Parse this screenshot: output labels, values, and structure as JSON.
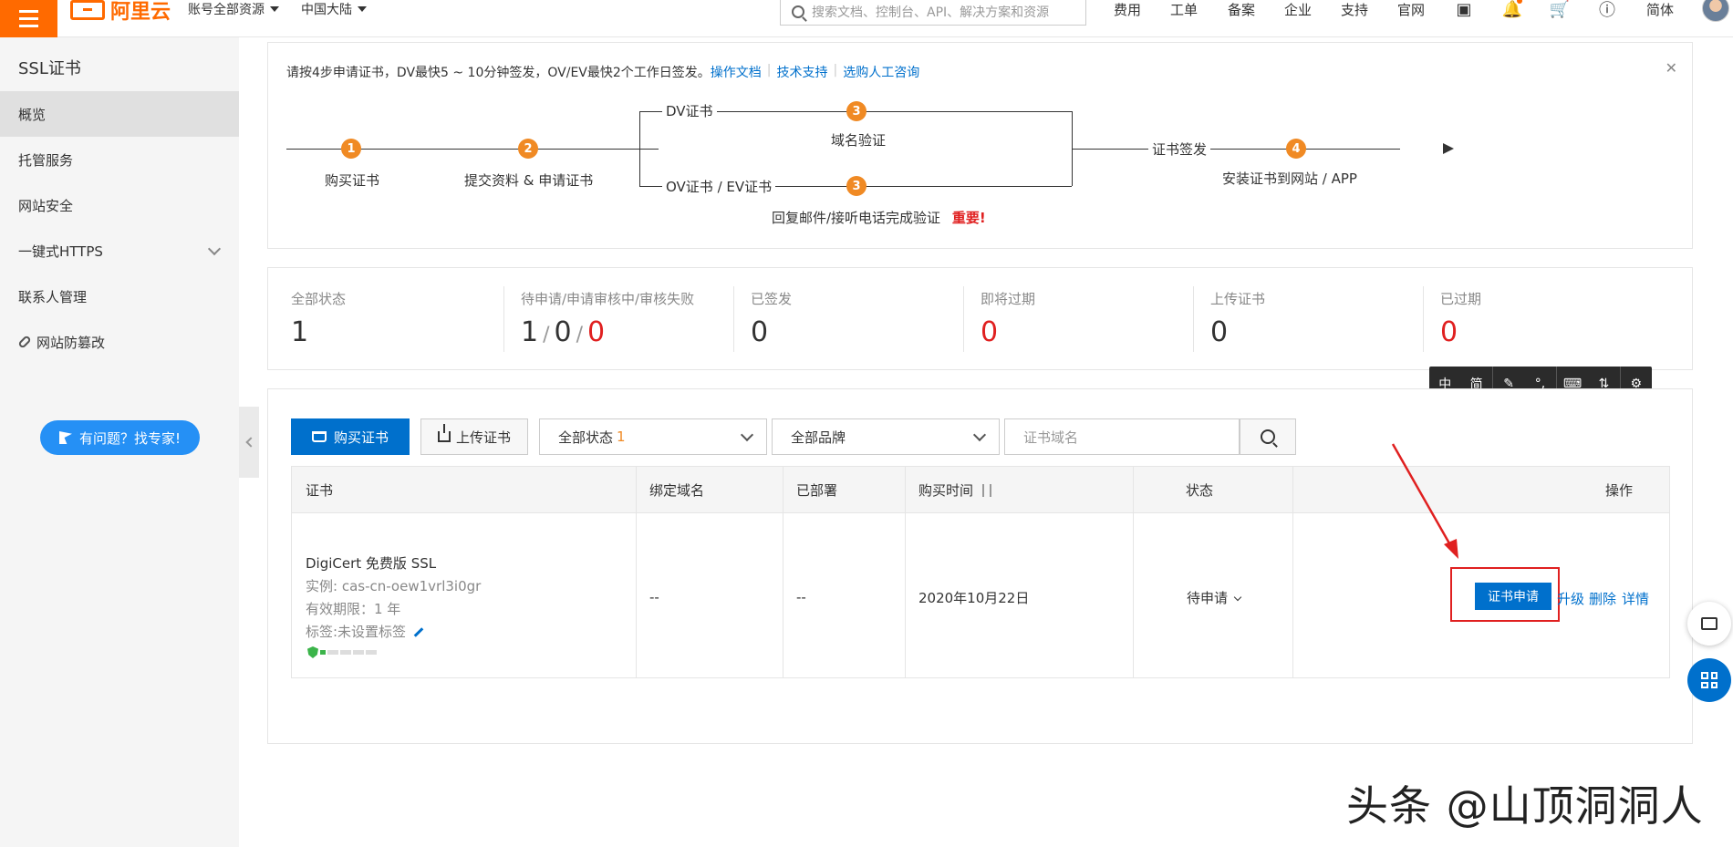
{
  "topbar": {
    "brand": "阿里云",
    "account_scope": "账号全部资源",
    "region": "中国大陆",
    "search_placeholder": "搜索文档、控制台、API、解决方案和资源",
    "nav": [
      "费用",
      "工单",
      "备案",
      "企业",
      "支持",
      "官网"
    ],
    "language": "简体"
  },
  "sidebar": {
    "title": "SSL证书",
    "items": [
      {
        "label": "概览",
        "active": true
      },
      {
        "label": "托管服务"
      },
      {
        "label": "网站安全"
      },
      {
        "label": "一键式HTTPS",
        "expandable": true
      },
      {
        "label": "联系人管理"
      },
      {
        "label": "网站防篡改",
        "icon": "link-icon"
      }
    ],
    "expert_button": "有问题？找专家!"
  },
  "guide": {
    "intro": "请按4步申请证书，DV最快5 ~ 10分钟签发，OV/EV最快2个工作日签发。",
    "links": [
      "操作文档",
      "技术支持",
      "选购人工咨询"
    ],
    "steps": {
      "s1": "1",
      "s2": "2",
      "s3": "3",
      "s4": "4",
      "buy": "购买证书",
      "submit": "提交资料 & 申请证书",
      "dv": "DV证书",
      "domain_verify": "域名验证",
      "ovev": "OV证书 / EV证书",
      "mail_verify": "回复邮件/接听电话完成验证",
      "important": "重要!",
      "issue": "证书签发",
      "install": "安装证书到网站 / APP"
    }
  },
  "stats": [
    {
      "label": "全部状态",
      "value": "1"
    },
    {
      "label": "待申请/申请审核中/审核失败",
      "values": [
        "1",
        "0",
        "0"
      ]
    },
    {
      "label": "已签发",
      "value": "0"
    },
    {
      "label": "即将过期",
      "value": "0",
      "red": true
    },
    {
      "label": "上传证书",
      "value": "0"
    },
    {
      "label": "已过期",
      "value": "0",
      "red": true
    }
  ],
  "float_toolbar": [
    "中",
    "简"
  ],
  "toolbar": {
    "buy": "购买证书",
    "upload": "上传证书",
    "status_filter": "全部状态",
    "status_count": "1",
    "brand_filter": "全部品牌",
    "domain_placeholder": "证书域名"
  },
  "table": {
    "headers": [
      "证书",
      "绑定域名",
      "已部署",
      "购买时间",
      "状态",
      "操作"
    ],
    "rows": [
      {
        "name": "DigiCert 免费版 SSL",
        "instance": "实例: cas-cn-oew1vrl3i0gr",
        "validity": "有效期限：1 年",
        "tags": "标签:未设置标签",
        "domain": "--",
        "deployed": "--",
        "purchase_time": "2020年10月22日",
        "status": "待申请",
        "actions": {
          "apply": "证书申请",
          "upgrade": "升级",
          "delete": "删除",
          "detail": "详情"
        }
      }
    ]
  },
  "watermark": "头条 @山顶洞洞人",
  "colors": {
    "accent": "#ff6a00",
    "primary": "#0070cc",
    "step": "#f08a24",
    "danger": "#e02020"
  }
}
